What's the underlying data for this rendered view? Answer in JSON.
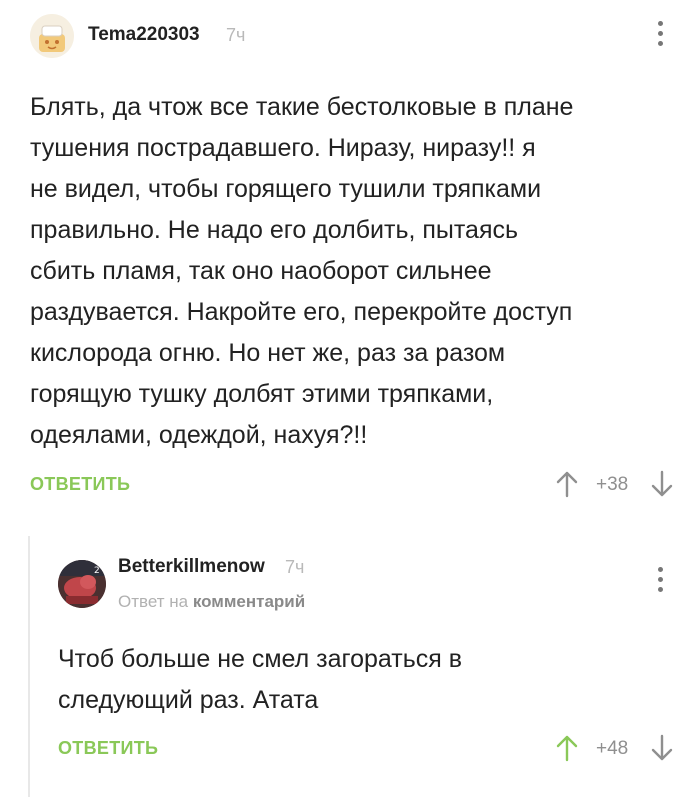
{
  "comments": [
    {
      "username": "Tema220303",
      "time": "7ч",
      "text": "Блять, да чтож все такие бестолковые в плане\nтушения пострадавшего. Ниразу, ниразу!! я\nне видел, чтобы горящего тушили тряпками\nправильно. Не надо его долбить, пытаясь\nсбить пламя, так оно наоборот сильнее\nраздувается. Накройте его, перекройте доступ\nкислорода огню. Но нет же, раз за разом\nгорящую тушку долбят этими тряпками,\nодеялами, одеждой, нахуя?!!",
      "reply_label": "ОТВЕТИТЬ",
      "rating": "+38",
      "up_color": "#8f8f8f"
    },
    {
      "username": "Betterkillmenow",
      "time": "7ч",
      "reply_prefix": "Ответ на",
      "reply_target": "комментарий",
      "text": "Чтоб больше не смел загораться в\nследующий раз. Атата",
      "reply_label": "ОТВЕТИТЬ",
      "rating": "+48",
      "up_color": "#8ac858"
    }
  ],
  "icons": {
    "menu": "vertical-dots-icon",
    "upvote": "arrow-up-icon",
    "downvote": "arrow-down-icon"
  },
  "colors": {
    "accent": "#8ac858",
    "muted": "#8f8f8f"
  }
}
